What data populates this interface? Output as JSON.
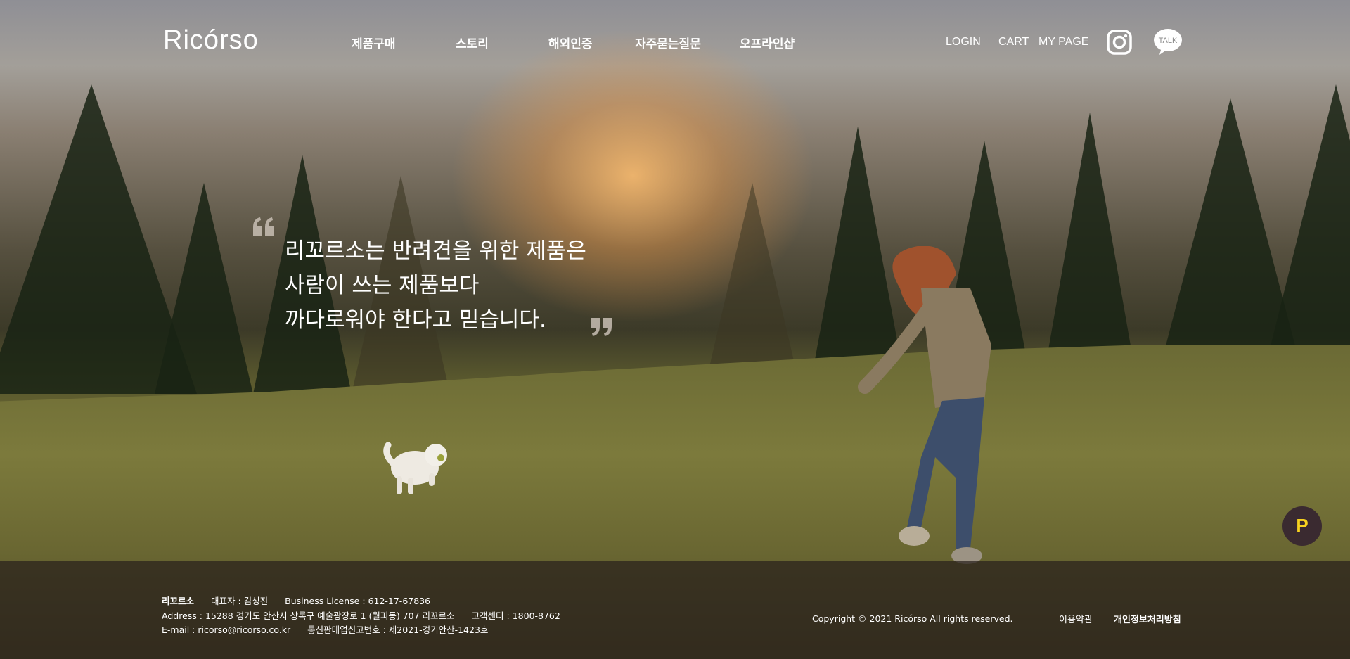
{
  "header": {
    "logo": "Ricórso",
    "nav": [
      "제품구매",
      "스토리",
      "해외인증",
      "자주묻는질문",
      "오프라인샵"
    ],
    "utility": {
      "login": "LOGIN",
      "cart": "CART",
      "mypage": "MY PAGE"
    },
    "icons": [
      "instagram-icon",
      "kakao-talk-icon"
    ],
    "talk_icon_text": "TALK"
  },
  "hero": {
    "quote": [
      "리꼬르소는 반려견을 위한 제품은",
      "사람이 쓰는 제품보다",
      "까다로워야 한다고 믿습니다."
    ]
  },
  "point_button": {
    "label": "P",
    "color": "#f7d21f"
  },
  "footer": {
    "company": "리꼬르소",
    "ceo": "대표자 : 김성진",
    "license": "Business License : 612-17-67836",
    "address": "Address : 15288 경기도 안산시 상록구 예술광장로 1 (월피동) 707 리꼬르소",
    "customer_center": "고객센터 : 1800-8762",
    "email": "E-mail : ricorso@ricorso.co.kr",
    "mail_order": "통신판매업신고번호 : 제2021-경기안산-1423호",
    "copyright": "Copyright © 2021 Ricórso All rights reserved.",
    "terms": "이용약관",
    "privacy": "개인정보처리방침"
  }
}
